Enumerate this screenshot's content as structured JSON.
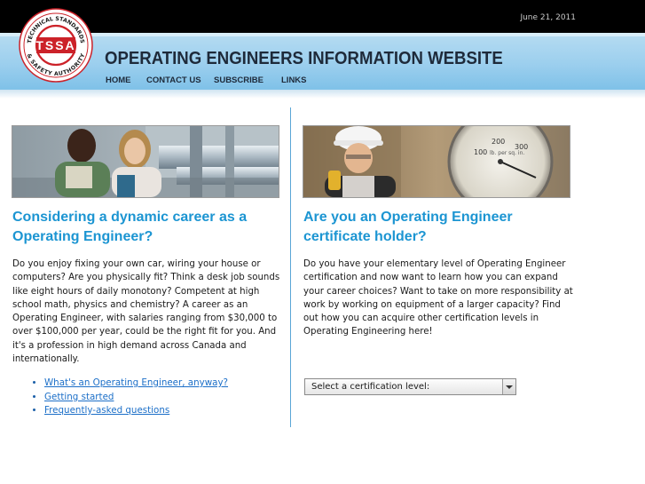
{
  "header": {
    "date": "June 21, 2011",
    "site_title": "OPERATING ENGINEERS INFORMATION WEBSITE",
    "logo": {
      "text_main": "TSSA",
      "text_ring_top": "TECHNICAL STANDARDS",
      "text_ring_bottom": "& SAFETY AUTHORITY"
    }
  },
  "nav": [
    {
      "label": "HOME"
    },
    {
      "label": "CONTACT US"
    },
    {
      "label": "SUBSCRIBE"
    },
    {
      "label": "LINKS"
    }
  ],
  "left": {
    "heading": "Considering a dynamic career as a Operating Engineer?",
    "body": "Do you enjoy fixing your own car, wiring your house or computers? Are you physically fit? Think a desk job sounds like eight hours of daily monotony? Competent at high school math, physics and chemistry? A career as an Operating Engineer, with salaries ranging from $30,000 to over $100,000 per year, could be the right fit for you. And it's a profession in high demand across Canada and internationally.",
    "links": [
      {
        "label": "What's an Operating Engineer, anyway?"
      },
      {
        "label": "Getting started"
      },
      {
        "label": "Frequently-asked questions"
      }
    ]
  },
  "right": {
    "heading": "Are you an Operating Engineer certificate holder?",
    "body": "Do you have your elementary level of Operating Engineer certification and now want to learn how you can expand your career choices? Want to take on more responsibility at work by working on equipment of a larger capacity? Find out how you can acquire other certification levels in Operating Engineering here!",
    "select": {
      "value": "Select a certification level:"
    },
    "gauge": {
      "numbers": [
        "100",
        "200",
        "300"
      ],
      "unit": "lb. per sq. in."
    }
  },
  "colors": {
    "accent": "#1c95d2",
    "banner": "#9ccfee",
    "title": "#1e2a3a",
    "logo_red": "#cc2229"
  }
}
